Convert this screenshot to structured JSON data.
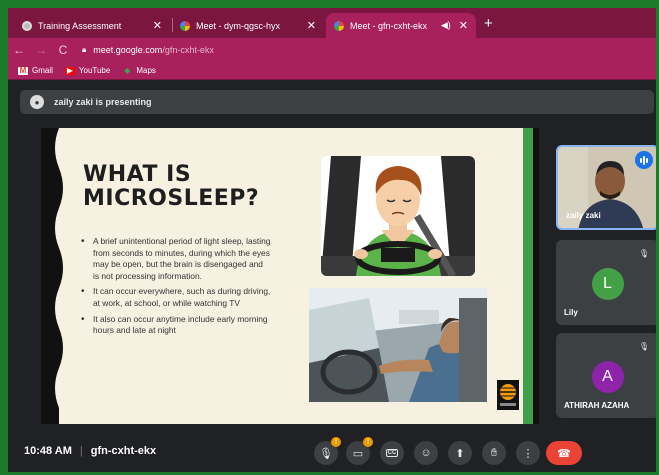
{
  "tabs": [
    {
      "title": "Training Assessment",
      "icon": "gear-icon",
      "active": false
    },
    {
      "title": "Meet - dym-qgsc-hyx",
      "icon": "meet-icon",
      "active": false
    },
    {
      "title": "Meet - gfn-cxht-ekx",
      "icon": "meet-icon",
      "active": true
    }
  ],
  "address": {
    "host": "meet.google.com",
    "path": "/gfn-cxht-ekx"
  },
  "bookmarks": [
    {
      "label": "Gmail",
      "icon": "gmail-icon"
    },
    {
      "label": "YouTube",
      "icon": "youtube-icon"
    },
    {
      "label": "Maps",
      "icon": "maps-icon"
    }
  ],
  "presenting": {
    "text": "zaily zaki is presenting"
  },
  "slide": {
    "title_line1": "WHAT IS",
    "title_line2": "MICROSLEEP?",
    "bullets": [
      "A brief unintentional period of light sleep, lasting from seconds to minutes, during which the eyes may be open, but the brain is disengaged and is not processing information.",
      "It can occur everywhere, such as during driving, at work, at school, or while watching TV",
      "It also can occur anytime include early morning hours and late at night"
    ]
  },
  "participants": [
    {
      "name": "zaily zaki",
      "speaking": true
    },
    {
      "name": "Lily",
      "initial": "L",
      "color": "#43a047",
      "muted": true
    },
    {
      "name": "ATHIRAH AZAHA",
      "initial": "A",
      "color": "#8e24aa",
      "muted": true
    }
  ],
  "meeting": {
    "time": "10:48 AM",
    "code": "gfn-cxht-ekx"
  },
  "controls": {
    "mic_badge": "!",
    "cam_badge": "!",
    "captions_label": "CC"
  },
  "colors": {
    "tabstrip": "#7a1640",
    "toolbar": "#a8205c",
    "end_call": "#ea4335",
    "slide_bg": "#f6f1e0",
    "slide_accent": "#3ea04a"
  }
}
